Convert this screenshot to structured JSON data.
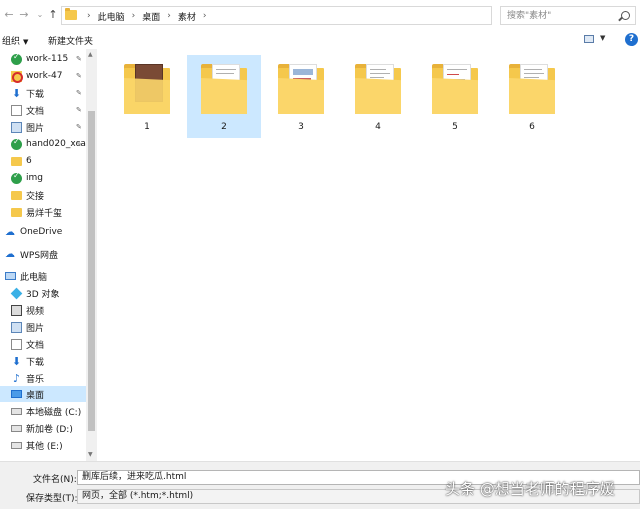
{
  "address_bar": {
    "crumbs": [
      "此电脑",
      "桌面",
      "素材"
    ],
    "search_placeholder": "搜索\"素材\""
  },
  "toolbar": {
    "organize_label": "组织",
    "new_folder_label": "新建文件夹"
  },
  "sidebar": {
    "quick_access": [
      {
        "label": "work-115",
        "icon": "check-folder-icon",
        "pinned": true
      },
      {
        "label": "work-47",
        "icon": "opera-folder-icon",
        "pinned": true
      },
      {
        "label": "下载",
        "icon": "download-icon",
        "pinned": true
      },
      {
        "label": "文档",
        "icon": "document-icon",
        "pinned": true
      },
      {
        "label": "图片",
        "icon": "picture-icon",
        "pinned": true
      },
      {
        "label": "hand020_xca",
        "icon": "check-folder-icon",
        "pinned": true
      },
      {
        "label": "6",
        "icon": "folder-icon",
        "pinned": false
      },
      {
        "label": "img",
        "icon": "check-folder-icon",
        "pinned": false
      },
      {
        "label": "交接",
        "icon": "folder-icon",
        "pinned": false
      },
      {
        "label": "易烊千玺",
        "icon": "folder-icon",
        "pinned": false
      }
    ],
    "onedrive": "OneDrive",
    "wps": "WPS网盘",
    "this_pc": "此电脑",
    "pc_items": [
      {
        "label": "3D 对象",
        "icon": "3d-objects-icon"
      },
      {
        "label": "视频",
        "icon": "video-icon"
      },
      {
        "label": "图片",
        "icon": "picture-icon"
      },
      {
        "label": "文档",
        "icon": "document-icon"
      },
      {
        "label": "下载",
        "icon": "download-icon"
      },
      {
        "label": "音乐",
        "icon": "music-icon"
      },
      {
        "label": "桌面",
        "icon": "desktop-icon",
        "selected": true
      },
      {
        "label": "本地磁盘 (C:)",
        "icon": "drive-icon"
      },
      {
        "label": "新加卷 (D:)",
        "icon": "drive-icon"
      },
      {
        "label": "其他 (E:)",
        "icon": "drive-icon"
      }
    ]
  },
  "files": [
    {
      "name": "1",
      "selected": false
    },
    {
      "name": "2",
      "selected": true
    },
    {
      "name": "3",
      "selected": false
    },
    {
      "name": "4",
      "selected": false
    },
    {
      "name": "5",
      "selected": false
    },
    {
      "name": "6",
      "selected": false
    }
  ],
  "bottom": {
    "filename_label": "文件名(N):",
    "filename_value": "删库后续，进来吃瓜.html",
    "filetype_label": "保存类型(T):",
    "filetype_value": "网页，全部 (*.htm;*.html)"
  },
  "watermark": "头条 @想当老师的程序媛"
}
